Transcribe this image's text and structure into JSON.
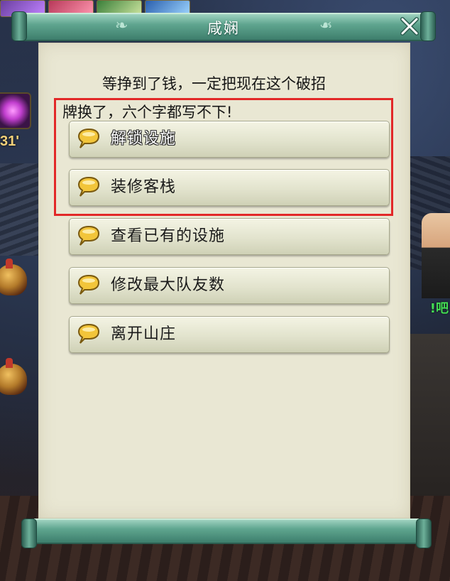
{
  "dialog": {
    "title": "咸娴",
    "npc_text_line1": "等挣到了钱，一定把现在这个破招",
    "npc_text_line2": "牌换了，六个字都写不下!",
    "options": [
      {
        "label": "解锁设施"
      },
      {
        "label": "装修客栈"
      },
      {
        "label": "查看已有的设施"
      },
      {
        "label": "修改最大队友数"
      },
      {
        "label": "离开山庄"
      }
    ]
  },
  "hud": {
    "level_text": "31'",
    "side_text": "!吧"
  },
  "colors": {
    "scroll_teal": "#5fa58f",
    "paper": "#e9e7d3",
    "highlight_border": "#e22828",
    "bubble_gold": "#f2c53a"
  },
  "icons": {
    "option_icon": "speech-bubble-icon",
    "close_icon": "close-icon"
  }
}
